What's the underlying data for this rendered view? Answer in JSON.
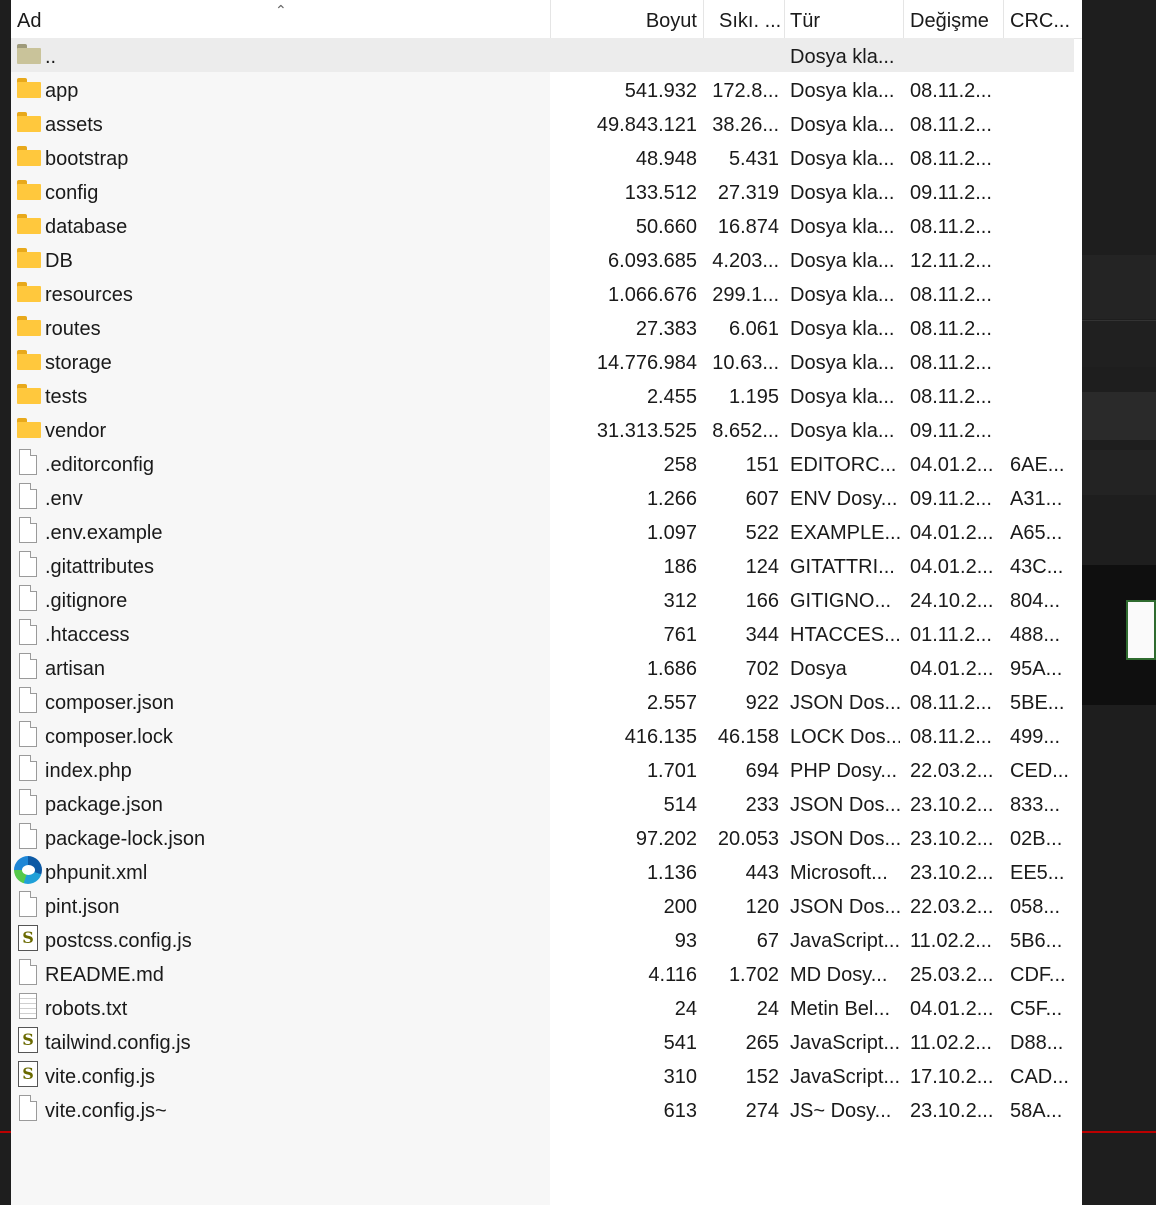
{
  "columns": {
    "name": "Ad",
    "size": "Boyut",
    "compressed": "Sıkı. ...",
    "type": "Tür",
    "modified": "Değişme",
    "crc": "CRC..."
  },
  "rows": [
    {
      "icon": "folder-up",
      "name": "..",
      "size": "",
      "compressed": "",
      "type": "Dosya kla...",
      "modified": "",
      "crc": ""
    },
    {
      "icon": "folder",
      "name": "app",
      "size": "541.932",
      "compressed": "172.8...",
      "type": "Dosya kla...",
      "modified": "08.11.2...",
      "crc": ""
    },
    {
      "icon": "folder",
      "name": "assets",
      "size": "49.843.121",
      "compressed": "38.26...",
      "type": "Dosya kla...",
      "modified": "08.11.2...",
      "crc": ""
    },
    {
      "icon": "folder",
      "name": "bootstrap",
      "size": "48.948",
      "compressed": "5.431",
      "type": "Dosya kla...",
      "modified": "08.11.2...",
      "crc": ""
    },
    {
      "icon": "folder",
      "name": "config",
      "size": "133.512",
      "compressed": "27.319",
      "type": "Dosya kla...",
      "modified": "09.11.2...",
      "crc": ""
    },
    {
      "icon": "folder",
      "name": "database",
      "size": "50.660",
      "compressed": "16.874",
      "type": "Dosya kla...",
      "modified": "08.11.2...",
      "crc": ""
    },
    {
      "icon": "folder",
      "name": "DB",
      "size": "6.093.685",
      "compressed": "4.203...",
      "type": "Dosya kla...",
      "modified": "12.11.2...",
      "crc": ""
    },
    {
      "icon": "folder",
      "name": "resources",
      "size": "1.066.676",
      "compressed": "299.1...",
      "type": "Dosya kla...",
      "modified": "08.11.2...",
      "crc": ""
    },
    {
      "icon": "folder",
      "name": "routes",
      "size": "27.383",
      "compressed": "6.061",
      "type": "Dosya kla...",
      "modified": "08.11.2...",
      "crc": ""
    },
    {
      "icon": "folder",
      "name": "storage",
      "size": "14.776.984",
      "compressed": "10.63...",
      "type": "Dosya kla...",
      "modified": "08.11.2...",
      "crc": ""
    },
    {
      "icon": "folder",
      "name": "tests",
      "size": "2.455",
      "compressed": "1.195",
      "type": "Dosya kla...",
      "modified": "08.11.2...",
      "crc": ""
    },
    {
      "icon": "folder",
      "name": "vendor",
      "size": "31.313.525",
      "compressed": "8.652...",
      "type": "Dosya kla...",
      "modified": "09.11.2...",
      "crc": ""
    },
    {
      "icon": "file",
      "name": ".editorconfig",
      "size": "258",
      "compressed": "151",
      "type": "EDITORC...",
      "modified": "04.01.2...",
      "crc": "6AE..."
    },
    {
      "icon": "file",
      "name": ".env",
      "size": "1.266",
      "compressed": "607",
      "type": "ENV Dosy...",
      "modified": "09.11.2...",
      "crc": "A31..."
    },
    {
      "icon": "file",
      "name": ".env.example",
      "size": "1.097",
      "compressed": "522",
      "type": "EXAMPLE...",
      "modified": "04.01.2...",
      "crc": "A65..."
    },
    {
      "icon": "file",
      "name": ".gitattributes",
      "size": "186",
      "compressed": "124",
      "type": "GITATTRI...",
      "modified": "04.01.2...",
      "crc": "43C..."
    },
    {
      "icon": "file",
      "name": ".gitignore",
      "size": "312",
      "compressed": "166",
      "type": "GITIGNO...",
      "modified": "24.10.2...",
      "crc": "804..."
    },
    {
      "icon": "file",
      "name": ".htaccess",
      "size": "761",
      "compressed": "344",
      "type": "HTACCES...",
      "modified": "01.11.2...",
      "crc": "488..."
    },
    {
      "icon": "file",
      "name": "artisan",
      "size": "1.686",
      "compressed": "702",
      "type": "Dosya",
      "modified": "04.01.2...",
      "crc": "95A..."
    },
    {
      "icon": "file",
      "name": "composer.json",
      "size": "2.557",
      "compressed": "922",
      "type": "JSON Dos...",
      "modified": "08.11.2...",
      "crc": "5BE..."
    },
    {
      "icon": "file",
      "name": "composer.lock",
      "size": "416.135",
      "compressed": "46.158",
      "type": "LOCK Dos...",
      "modified": "08.11.2...",
      "crc": "499..."
    },
    {
      "icon": "file",
      "name": "index.php",
      "size": "1.701",
      "compressed": "694",
      "type": "PHP Dosy...",
      "modified": "22.03.2...",
      "crc": "CED..."
    },
    {
      "icon": "file",
      "name": "package.json",
      "size": "514",
      "compressed": "233",
      "type": "JSON Dos...",
      "modified": "23.10.2...",
      "crc": "833..."
    },
    {
      "icon": "file",
      "name": "package-lock.json",
      "size": "97.202",
      "compressed": "20.053",
      "type": "JSON Dos...",
      "modified": "23.10.2...",
      "crc": "02B..."
    },
    {
      "icon": "edge",
      "name": "phpunit.xml",
      "size": "1.136",
      "compressed": "443",
      "type": "Microsoft...",
      "modified": "23.10.2...",
      "crc": "EE5..."
    },
    {
      "icon": "file",
      "name": "pint.json",
      "size": "200",
      "compressed": "120",
      "type": "JSON Dos...",
      "modified": "22.03.2...",
      "crc": "058..."
    },
    {
      "icon": "js",
      "name": "postcss.config.js",
      "size": "93",
      "compressed": "67",
      "type": "JavaScript...",
      "modified": "11.02.2...",
      "crc": "5B6..."
    },
    {
      "icon": "file",
      "name": "README.md",
      "size": "4.116",
      "compressed": "1.702",
      "type": "MD Dosy...",
      "modified": "25.03.2...",
      "crc": "CDF..."
    },
    {
      "icon": "text",
      "name": "robots.txt",
      "size": "24",
      "compressed": "24",
      "type": "Metin Bel...",
      "modified": "04.01.2...",
      "crc": "C5F..."
    },
    {
      "icon": "js",
      "name": "tailwind.config.js",
      "size": "541",
      "compressed": "265",
      "type": "JavaScript...",
      "modified": "11.02.2...",
      "crc": "D88..."
    },
    {
      "icon": "js",
      "name": "vite.config.js",
      "size": "310",
      "compressed": "152",
      "type": "JavaScript...",
      "modified": "17.10.2...",
      "crc": "CAD..."
    },
    {
      "icon": "file",
      "name": "vite.config.js~",
      "size": "613",
      "compressed": "274",
      "type": "JS~ Dosy...",
      "modified": "23.10.2...",
      "crc": "58A..."
    }
  ],
  "js_icon_glyph": "S",
  "colors": {
    "folder": "#ffc83d",
    "selected_row": "#ececec",
    "background": "#1b1b1b"
  }
}
